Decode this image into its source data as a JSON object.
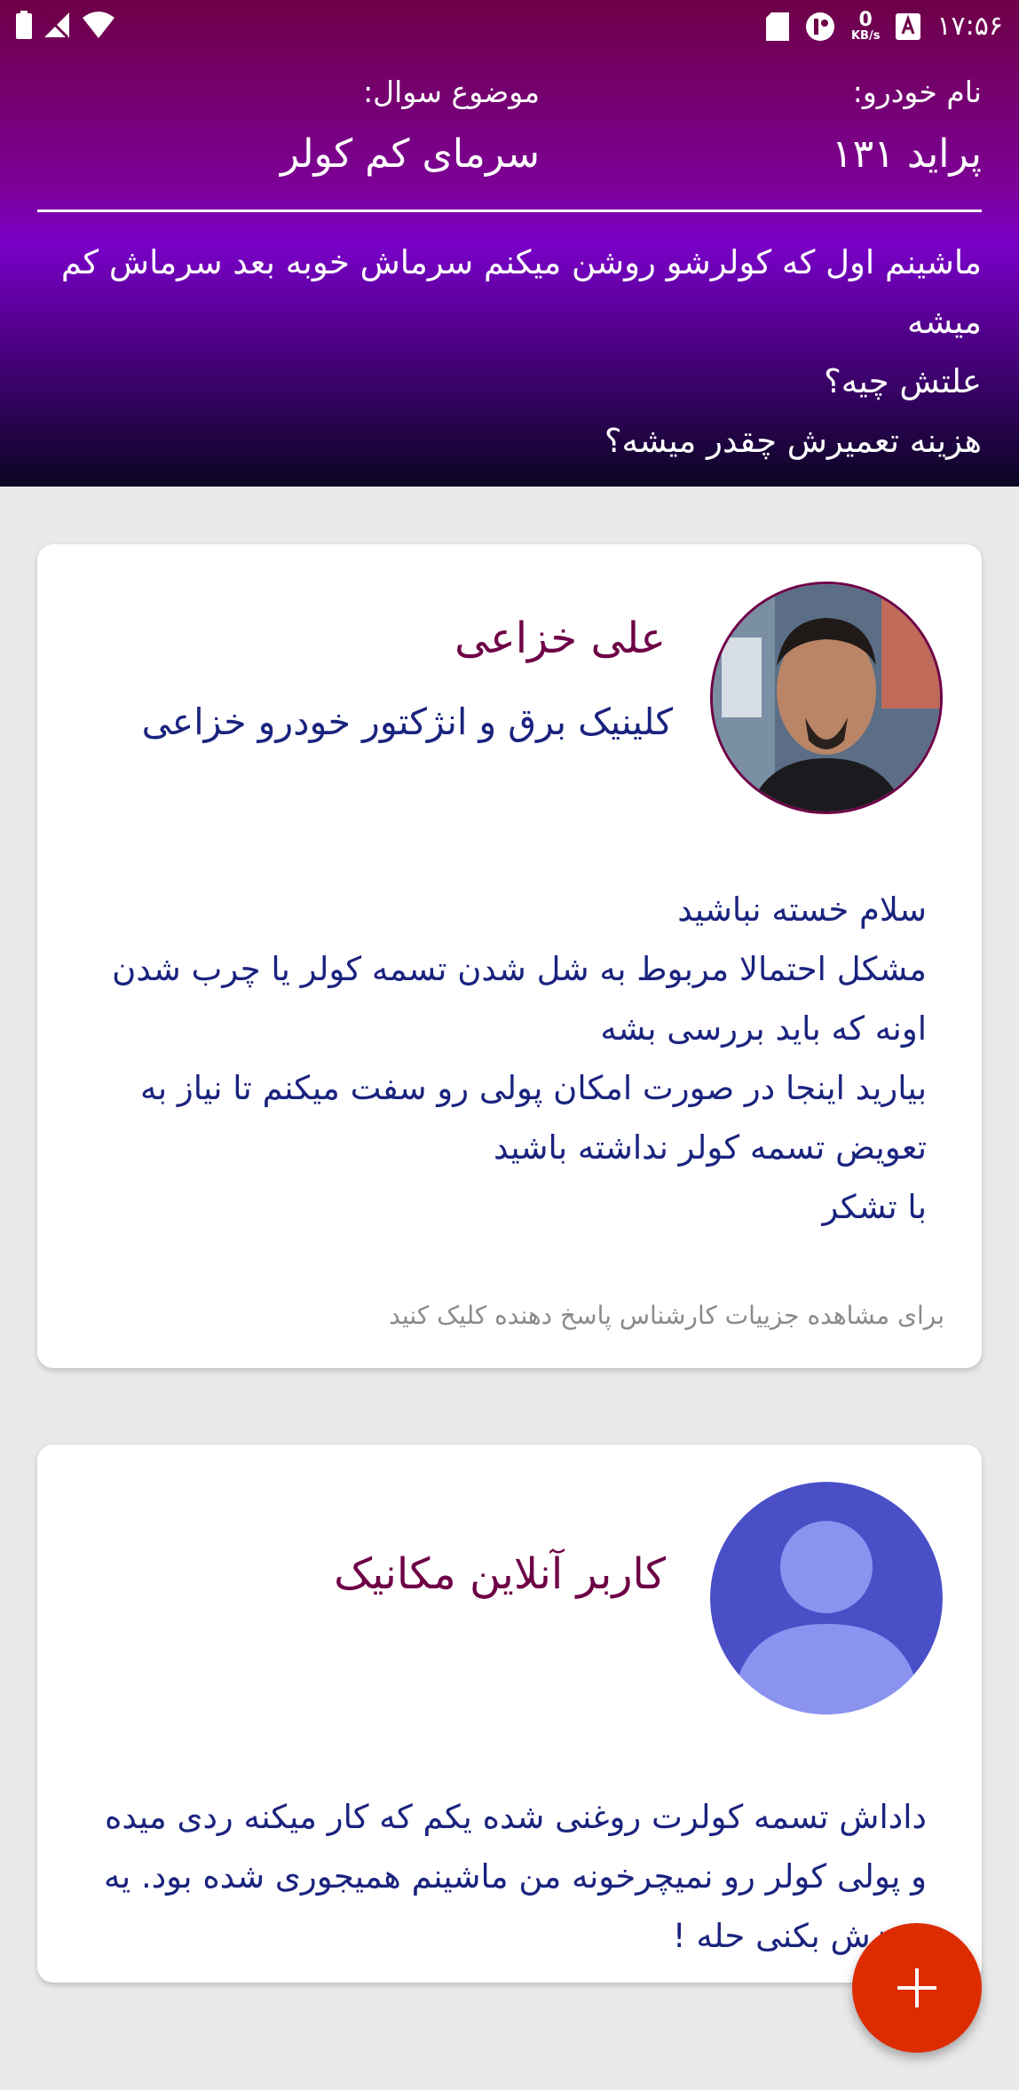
{
  "statusbar": {
    "time": "۱۷:۵۶",
    "net_speed_value": "0",
    "net_speed_unit": "KB/s"
  },
  "question": {
    "car_label": "نام خودرو:",
    "car_value": "پراید ۱۳۱",
    "topic_label": "موضوع سوال:",
    "topic_value": "سرمای کم کولر",
    "lines": [
      "ماشینم اول که کولرشو روشن میکنم سرماش خوبه بعد سرماش کم میشه",
      "علتش چیه؟",
      "هزینه تعمیرش چقدر میشه؟"
    ]
  },
  "answers": [
    {
      "name": "علی خزاعی",
      "company": "کلینیک برق و انژکتور خودرو خزاعی",
      "lines": [
        "سلام خسته نباشید",
        "مشکل احتمالا مربوط به شل شدن تسمه کولر یا چرب شدن اونه که باید بررسی بشه",
        "بیارید اینجا در صورت امکان پولی رو سفت میکنم تا نیاز به تعویض تسمه کولر   نداشته باشید",
        "با تشکر"
      ],
      "footnote": "برای مشاهده جزییات کارشناس پاسخ دهنده کلیک کنید"
    },
    {
      "name": "کاربر آنلاین مکانیک",
      "lines": [
        "داداش تسمه کولرت روغنی شده یکم که کار میکنه ردی میده و پولی کولر رو نمیچرخونه من ماشینم همیجوری شده بود. یه تمیزش بکنی حله !"
      ]
    }
  ],
  "fab": {
    "icon": "plus-icon"
  },
  "colors": {
    "accent_name": "#6e0046",
    "answer_text": "#1a237e",
    "fab": "#dd2c00"
  }
}
